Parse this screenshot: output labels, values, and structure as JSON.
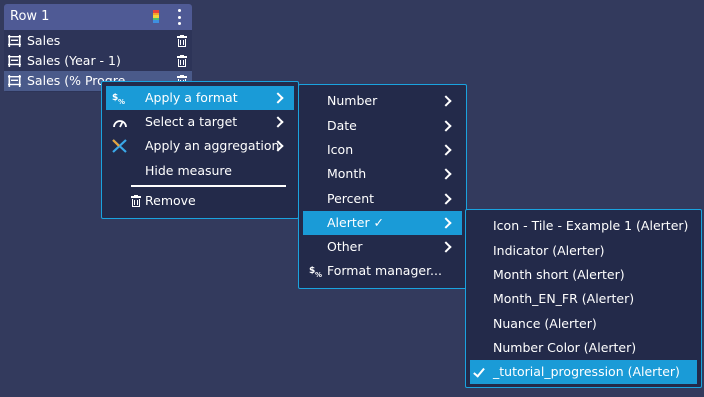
{
  "panel": {
    "title": "Row 1",
    "measures": [
      {
        "label": "Sales"
      },
      {
        "label": "Sales (Year - 1)"
      },
      {
        "label": "Sales (% Progre"
      }
    ]
  },
  "context_menu": {
    "items": [
      {
        "label": "Apply a format",
        "icon": "format-icon",
        "submenu": true
      },
      {
        "label": "Select a target",
        "icon": "gauge-icon",
        "submenu": true
      },
      {
        "label": "Apply an aggregation",
        "icon": "aggregation-icon",
        "submenu": true
      },
      {
        "label": "Hide measure"
      },
      {
        "label": "Remove",
        "icon": "trash-icon"
      }
    ]
  },
  "format_menu": {
    "items": [
      {
        "label": "Number"
      },
      {
        "label": "Date"
      },
      {
        "label": "Icon"
      },
      {
        "label": "Month"
      },
      {
        "label": "Percent"
      },
      {
        "label": "Alerter ✓",
        "selected": true
      },
      {
        "label": "Other"
      },
      {
        "label": "Format manager..."
      }
    ]
  },
  "alerter_menu": {
    "items": [
      {
        "label": "Icon - Tile - Example 1 (Alerter)"
      },
      {
        "label": "Indicator (Alerter)"
      },
      {
        "label": "Month short (Alerter)"
      },
      {
        "label": "Month_EN_FR (Alerter)"
      },
      {
        "label": "Nuance (Alerter)"
      },
      {
        "label": "Number Color (Alerter)"
      },
      {
        "label": "_tutorial_progression (Alerter)",
        "checked": true
      }
    ]
  },
  "colors": {
    "background": "#333a5d",
    "panel_header": "#4f5a95",
    "menu_bg": "#232a4a",
    "accent": "#1a9bd7"
  }
}
